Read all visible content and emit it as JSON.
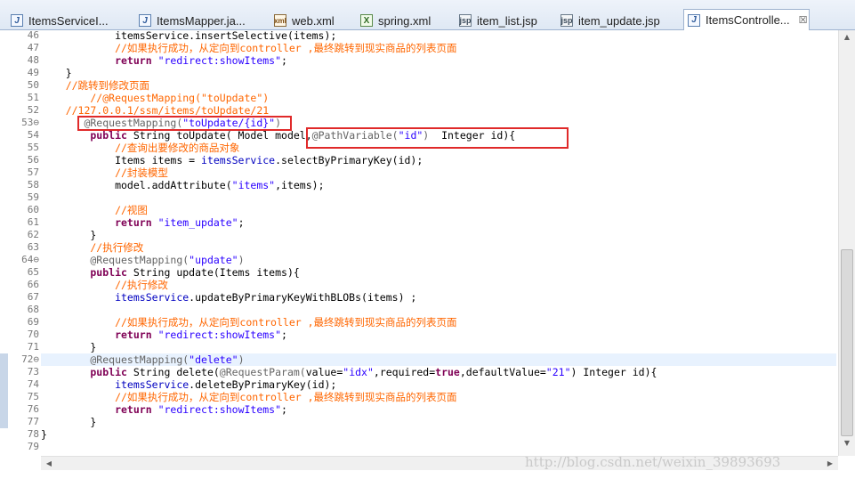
{
  "tabs": [
    {
      "label": "ItemsServiceI...",
      "icon": "java-file-icon"
    },
    {
      "label": "ItemsMapper.ja...",
      "icon": "java-file-icon"
    },
    {
      "label": "web.xml",
      "icon": "xml-file-icon"
    },
    {
      "label": "spring.xml",
      "icon": "spring-xml-icon"
    },
    {
      "label": "item_list.jsp",
      "icon": "jsp-file-icon"
    },
    {
      "label": "item_update.jsp",
      "icon": "jsp-file-icon"
    },
    {
      "label": "ItemsControlle...",
      "icon": "java-file-icon",
      "close": "☒"
    }
  ],
  "icon_glyphs": {
    "java": "J",
    "xml": "xml",
    "spring": "X",
    "jsp": "jsp"
  },
  "colors": {
    "comment": "#ff6600",
    "keyword": "#7f0055",
    "string": "#2a00ff",
    "annotation": "#646464",
    "highlight_box": "#e02a2a",
    "current_line": "#e8f2fe"
  },
  "code_lines": [
    {
      "n": "46",
      "marker": "",
      "tokens": [
        [
          "tx",
          "            itemsService.insertSelective(items);"
        ]
      ]
    },
    {
      "n": "47",
      "marker": "",
      "tokens": [
        [
          "cm",
          "            //如果执行成功，从定向到controller ,最终跳转到现实商品的列表页面"
        ]
      ]
    },
    {
      "n": "48",
      "marker": "",
      "tokens": [
        [
          "kw",
          "            return "
        ],
        [
          "st",
          "\"redirect:showItems\""
        ],
        [
          "tx",
          ";"
        ]
      ]
    },
    {
      "n": "49",
      "marker": "",
      "tokens": [
        [
          "tx",
          "    }"
        ]
      ]
    },
    {
      "n": "50",
      "marker": "",
      "tokens": [
        [
          "cm",
          "    //跳转到修改页面"
        ]
      ]
    },
    {
      "n": "51",
      "marker": "",
      "tokens": [
        [
          "cm",
          "        //@RequestMapping(\"toUpdate\")"
        ]
      ]
    },
    {
      "n": "52",
      "marker": "",
      "tokens": [
        [
          "cm",
          "    //127.0.0.1/ssm/items/toUpdate/21"
        ]
      ]
    },
    {
      "n": "53",
      "marker": "⊖",
      "tokens": [
        [
          "an",
          "       @RequestMapping("
        ],
        [
          "st",
          "\"toUpdate/{id}\""
        ],
        [
          "an",
          ")"
        ]
      ]
    },
    {
      "n": "54",
      "marker": "",
      "tokens": [
        [
          "kw",
          "        public "
        ],
        [
          "tx",
          "String toUpdate( Model model,"
        ],
        [
          "an",
          "@PathVariable("
        ],
        [
          "st",
          "\"id\""
        ],
        [
          "an",
          ")"
        ],
        [
          "tx",
          "  Integer id){"
        ]
      ]
    },
    {
      "n": "55",
      "marker": "",
      "tokens": [
        [
          "cm",
          "            //查询出要修改的商品对象"
        ]
      ]
    },
    {
      "n": "56",
      "marker": "",
      "tokens": [
        [
          "tx",
          "            Items items = "
        ],
        [
          "fd",
          "itemsService"
        ],
        [
          "tx",
          ".selectByPrimaryKey(id);"
        ]
      ]
    },
    {
      "n": "57",
      "marker": "",
      "tokens": [
        [
          "cm",
          "            //封装模型"
        ]
      ]
    },
    {
      "n": "58",
      "marker": "",
      "tokens": [
        [
          "tx",
          "            model.addAttribute("
        ],
        [
          "st",
          "\"items\""
        ],
        [
          "tx",
          ",items);"
        ]
      ]
    },
    {
      "n": "59",
      "marker": "",
      "tokens": []
    },
    {
      "n": "60",
      "marker": "",
      "tokens": [
        [
          "cm",
          "            //视图"
        ]
      ]
    },
    {
      "n": "61",
      "marker": "",
      "tokens": [
        [
          "kw",
          "            return "
        ],
        [
          "st",
          "\"item_update\""
        ],
        [
          "tx",
          ";"
        ]
      ]
    },
    {
      "n": "62",
      "marker": "",
      "tokens": [
        [
          "tx",
          "        }"
        ]
      ]
    },
    {
      "n": "63",
      "marker": "",
      "tokens": [
        [
          "cm",
          "        //执行修改"
        ]
      ]
    },
    {
      "n": "64",
      "marker": "⊖",
      "tokens": [
        [
          "an",
          "        @RequestMapping("
        ],
        [
          "st",
          "\"update\""
        ],
        [
          "an",
          ")"
        ]
      ]
    },
    {
      "n": "65",
      "marker": "",
      "tokens": [
        [
          "kw",
          "        public "
        ],
        [
          "tx",
          "String update(Items items){"
        ]
      ]
    },
    {
      "n": "66",
      "marker": "",
      "tokens": [
        [
          "cm",
          "            //执行修改"
        ]
      ]
    },
    {
      "n": "67",
      "marker": "",
      "tokens": [
        [
          "fd",
          "            itemsService"
        ],
        [
          "tx",
          ".updateByPrimaryKeyWithBLOBs(items) ;"
        ]
      ]
    },
    {
      "n": "68",
      "marker": "",
      "tokens": []
    },
    {
      "n": "69",
      "marker": "",
      "tokens": [
        [
          "cm",
          "            //如果执行成功，从定向到controller ,最终跳转到现实商品的列表页面"
        ]
      ]
    },
    {
      "n": "70",
      "marker": "",
      "tokens": [
        [
          "kw",
          "            return "
        ],
        [
          "st",
          "\"redirect:showItems\""
        ],
        [
          "tx",
          ";"
        ]
      ]
    },
    {
      "n": "71",
      "marker": "",
      "tokens": [
        [
          "tx",
          "        }"
        ]
      ]
    },
    {
      "n": "72",
      "marker": "⊖",
      "tokens": [
        [
          "an",
          "        @RequestMapping("
        ],
        [
          "st",
          "\"delete\""
        ],
        [
          "an",
          ")"
        ]
      ]
    },
    {
      "n": "73",
      "marker": "",
      "tokens": [
        [
          "kw",
          "        public "
        ],
        [
          "tx",
          "String delete("
        ],
        [
          "an",
          "@RequestParam("
        ],
        [
          "tx",
          "value="
        ],
        [
          "st",
          "\"idx\""
        ],
        [
          "tx",
          ",required="
        ],
        [
          "kw",
          "true"
        ],
        [
          "tx",
          ",defaultValue="
        ],
        [
          "st",
          "\"21\""
        ],
        [
          "tx",
          ") Integer id){"
        ]
      ]
    },
    {
      "n": "74",
      "marker": "",
      "tokens": [
        [
          "fd",
          "            itemsService"
        ],
        [
          "tx",
          ".deleteByPrimaryKey(id);"
        ]
      ]
    },
    {
      "n": "75",
      "marker": "",
      "tokens": [
        [
          "cm",
          "            //如果执行成功，从定向到controller ,最终跳转到现实商品的列表页面"
        ]
      ]
    },
    {
      "n": "76",
      "marker": "",
      "tokens": [
        [
          "kw",
          "            return "
        ],
        [
          "st",
          "\"redirect:showItems\""
        ],
        [
          "tx",
          ";"
        ]
      ]
    },
    {
      "n": "77",
      "marker": "",
      "tokens": [
        [
          "tx",
          "        }"
        ]
      ]
    },
    {
      "n": "78",
      "marker": "",
      "tokens": [
        [
          "tx",
          "}"
        ]
      ]
    },
    {
      "n": "79",
      "marker": "",
      "tokens": []
    }
  ],
  "current_line": "72",
  "watermark": "http://blog.csdn.net/weixin_39893693",
  "scroll_arrows": {
    "up": "▲",
    "down": "▼",
    "left": "◀",
    "right": "▶"
  }
}
